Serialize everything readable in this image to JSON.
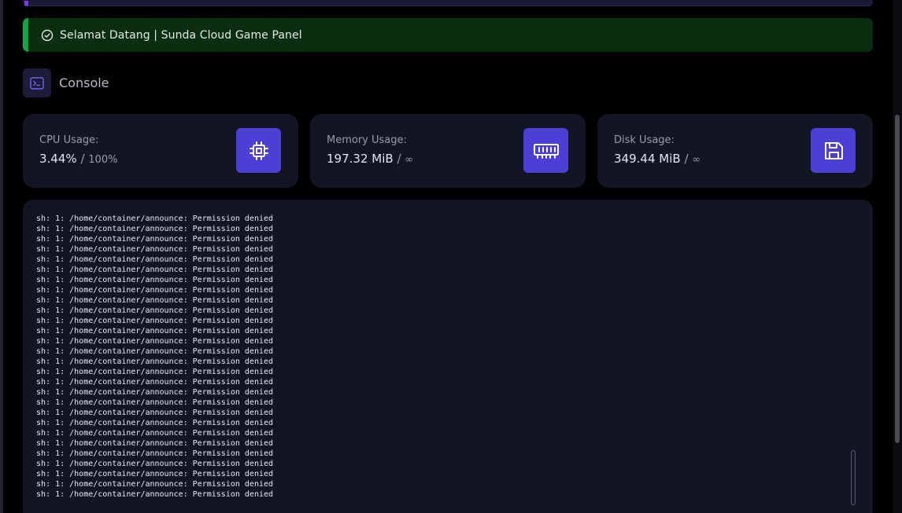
{
  "welcome": {
    "message": "Selamat Datang | Sunda Cloud Game Panel",
    "icon": "check-circle-icon",
    "accent_color": "#16a34a"
  },
  "console_header": {
    "title": "Console",
    "icon": "terminal-icon"
  },
  "stats": {
    "cpu": {
      "label": "CPU Usage:",
      "value": "3.44%",
      "separator": "/",
      "max": "100%",
      "icon": "cpu-icon"
    },
    "memory": {
      "label": "Memory Usage:",
      "value": "197.32 MiB",
      "separator": "/",
      "max": "∞",
      "icon": "memory-icon"
    },
    "disk": {
      "label": "Disk Usage:",
      "value": "349.44 MiB",
      "separator": "/",
      "max": "∞",
      "icon": "save-icon"
    }
  },
  "console": {
    "lines": [
      "sh: 1: /home/container/announce: Permission denied",
      "sh: 1: /home/container/announce: Permission denied",
      "sh: 1: /home/container/announce: Permission denied",
      "sh: 1: /home/container/announce: Permission denied",
      "sh: 1: /home/container/announce: Permission denied",
      "sh: 1: /home/container/announce: Permission denied",
      "sh: 1: /home/container/announce: Permission denied",
      "sh: 1: /home/container/announce: Permission denied",
      "sh: 1: /home/container/announce: Permission denied",
      "sh: 1: /home/container/announce: Permission denied",
      "sh: 1: /home/container/announce: Permission denied",
      "sh: 1: /home/container/announce: Permission denied",
      "sh: 1: /home/container/announce: Permission denied",
      "sh: 1: /home/container/announce: Permission denied",
      "sh: 1: /home/container/announce: Permission denied",
      "sh: 1: /home/container/announce: Permission denied",
      "sh: 1: /home/container/announce: Permission denied",
      "sh: 1: /home/container/announce: Permission denied",
      "sh: 1: /home/container/announce: Permission denied",
      "sh: 1: /home/container/announce: Permission denied",
      "sh: 1: /home/container/announce: Permission denied",
      "sh: 1: /home/container/announce: Permission denied",
      "sh: 1: /home/container/announce: Permission denied",
      "sh: 1: /home/container/announce: Permission denied",
      "sh: 1: /home/container/announce: Permission denied",
      "sh: 1: /home/container/announce: Permission denied",
      "sh: 1: /home/container/announce: Permission denied",
      "sh: 1: /home/container/announce: Permission denied"
    ]
  },
  "colors": {
    "accent": "#4b3fd6",
    "card_bg": "#131525",
    "page_bg": "#000000"
  }
}
